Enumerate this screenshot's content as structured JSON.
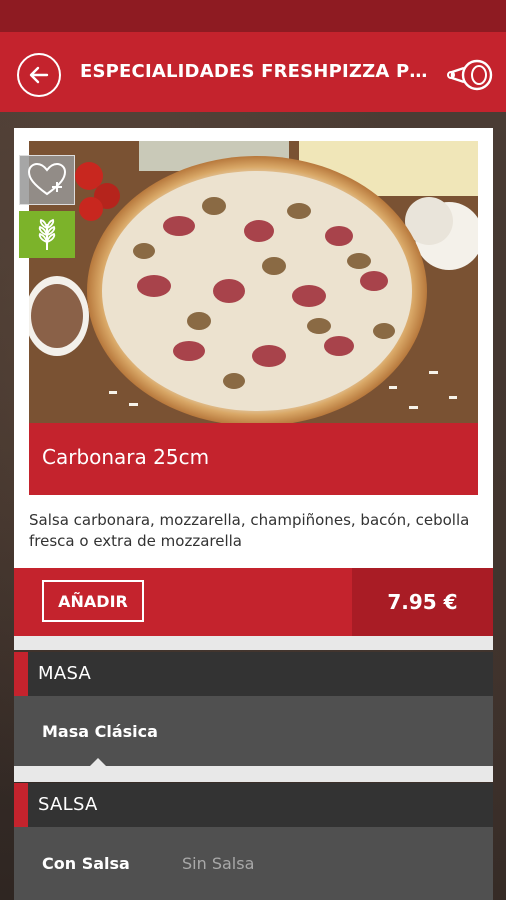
{
  "header": {
    "title": "ESPECIALIDADES FRESHPIZZA PEQUEÑAS",
    "back_icon": "arrow-left-circle-icon",
    "action_icon": "ham-icon"
  },
  "product": {
    "name": "Carbonara 25cm",
    "description": "Salsa carbonara, mozzarella, champiñones, bacón, cebolla fresca o extra de mozzarella",
    "favorite_icon": "heart-plus-icon",
    "vegetarian_icon": "wheat-icon",
    "price": "7.95 €",
    "add_label": "AÑADIR"
  },
  "sections": [
    {
      "title": "MASA",
      "options": [
        {
          "label": "Masa Clásica",
          "selected": true
        }
      ]
    },
    {
      "title": "SALSA",
      "options": [
        {
          "label": "Con Salsa",
          "selected": true
        },
        {
          "label": "Sin Salsa",
          "selected": false
        }
      ]
    }
  ],
  "colors": {
    "brand_red": "#c4232d",
    "dark_red": "#a91c25",
    "section_dark": "#333333",
    "option_bg": "#505050",
    "veg_green": "#7cb32a"
  }
}
